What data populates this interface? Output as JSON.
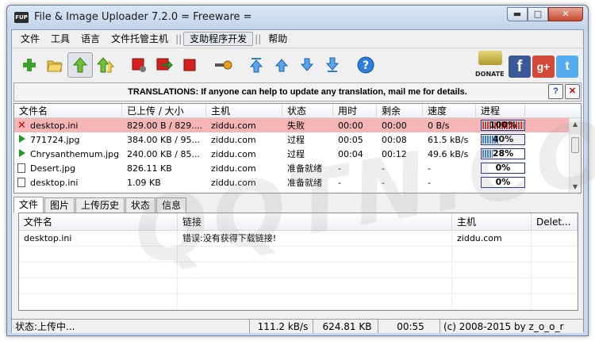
{
  "window": {
    "title": "File & Image Uploader 7.2.0  = Freeware =",
    "app_icon_text": "FUP",
    "min_glyph": "▬",
    "max_glyph": "□",
    "close_glyph": "✕"
  },
  "menu": {
    "file": "文件",
    "tools": "工具",
    "language": "语言",
    "hosts": "文件托管主机",
    "sep1": "||",
    "support": "支助程序开发",
    "sep2": "||",
    "help": "帮助"
  },
  "toolbar": {
    "icons": [
      "add-icon",
      "open-folder-icon",
      "upload-icon",
      "upload-all-icon",
      "stop-record-icon",
      "move-icon",
      "stop-icon",
      "key-icon",
      "move-top-icon",
      "move-up-icon",
      "move-down-icon",
      "move-bottom-icon",
      "help-icon"
    ]
  },
  "donate": {
    "label": "DONATE"
  },
  "banner": {
    "text": "TRANSLATIONS: If anyone can help to update any translation, mail me for details.",
    "help_glyph": "?",
    "close_glyph": "✕"
  },
  "uploads": {
    "columns": [
      "文件名",
      "已上传 / 大小",
      "主机",
      "状态",
      "用时",
      "剩余",
      "速度",
      "进程"
    ],
    "rows": [
      {
        "icon": "failed-icon",
        "name": "desktop.ini",
        "size": "829.00 B / 829....",
        "host": "ziddu.com",
        "status": "失败",
        "time": "00:00",
        "remaining": "00:00",
        "speed": "0 B/s",
        "progress_label": "100%",
        "progress": 1.0,
        "failed": true
      },
      {
        "icon": "play-icon",
        "name": "771724.jpg",
        "size": "384.00 KB / 95...",
        "host": "ziddu.com",
        "status": "过程",
        "time": "00:05",
        "remaining": "00:08",
        "speed": "61.5 kB/s",
        "progress_label": "40%",
        "progress": 0.4,
        "failed": false
      },
      {
        "icon": "play-icon",
        "name": "Chrysanthemum.jpg",
        "size": "240.00 KB / 85...",
        "host": "ziddu.com",
        "status": "过程",
        "time": "00:04",
        "remaining": "00:12",
        "speed": "49.6 kB/s",
        "progress_label": "28%",
        "progress": 0.28,
        "failed": false
      },
      {
        "icon": "document-icon",
        "name": "Desert.jpg",
        "size": "826.11 KB",
        "host": "ziddu.com",
        "status": "准备就绪",
        "time": "-",
        "remaining": "-",
        "speed": "-",
        "progress_label": "0%",
        "progress": 0,
        "failed": false
      },
      {
        "icon": "document-icon",
        "name": "desktop.ini",
        "size": "1.09 KB",
        "host": "ziddu.com",
        "status": "准备就绪",
        "time": "-",
        "remaining": "-",
        "speed": "-",
        "progress_label": "0%",
        "progress": 0,
        "failed": false
      }
    ]
  },
  "tabs": [
    "文件",
    "图片",
    "上传历史",
    "状态",
    "信息"
  ],
  "links": {
    "columns": [
      "文件名",
      "链接",
      "主机",
      "Delet..."
    ],
    "rows": [
      {
        "name": "desktop.ini",
        "link": "错误:没有获得下载链接!",
        "host": "ziddu.com",
        "delete": ""
      }
    ]
  },
  "statusbar": {
    "status": "状态:上传中...",
    "speed": "111.2 kB/s",
    "size": "624.81 KB",
    "time": "00:55",
    "copyright": "(c) 2008-2015 by z_o_o_r"
  },
  "colors": {
    "fail_row": "#f6b6b6",
    "progress_fail": "#e03030",
    "progress_ok": "#3a7bd5"
  },
  "watermark": "QQTN.COM"
}
